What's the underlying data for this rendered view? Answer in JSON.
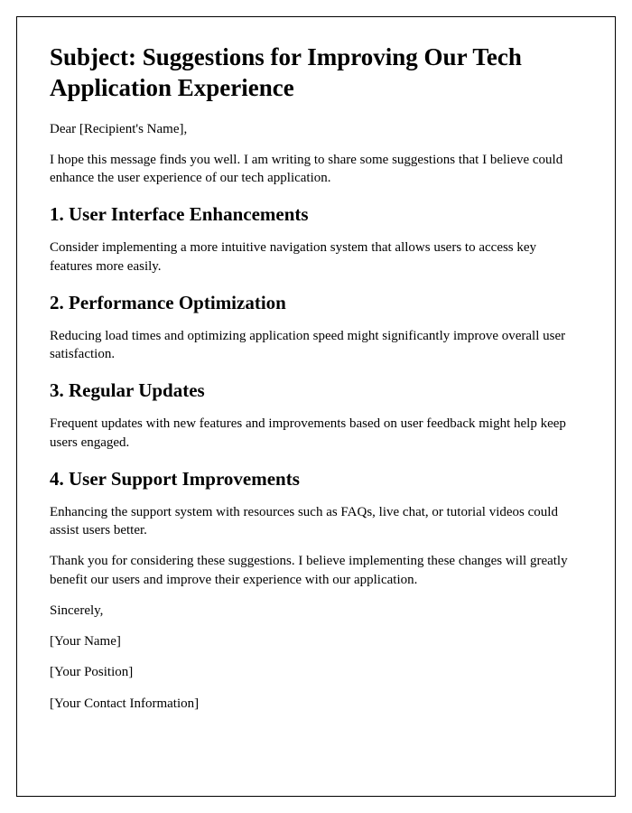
{
  "subject_line": "Subject: Suggestions for Improving Our Tech Application Experience",
  "salutation": "Dear [Recipient's Name],",
  "intro": "I hope this message finds you well. I am writing to share some suggestions that I believe could enhance the user experience of our tech application.",
  "sections": [
    {
      "heading": "1. User Interface Enhancements",
      "body": "Consider implementing a more intuitive navigation system that allows users to access key features more easily."
    },
    {
      "heading": "2. Performance Optimization",
      "body": "Reducing load times and optimizing application speed might significantly improve overall user satisfaction."
    },
    {
      "heading": "3. Regular Updates",
      "body": "Frequent updates with new features and improvements based on user feedback might help keep users engaged."
    },
    {
      "heading": "4. User Support Improvements",
      "body": "Enhancing the support system with resources such as FAQs, live chat, or tutorial videos could assist users better."
    }
  ],
  "closing_paragraph": "Thank you for considering these suggestions. I believe implementing these changes will greatly benefit our users and improve their experience with our application.",
  "signoff": "Sincerely,",
  "signature_name": "[Your Name]",
  "signature_position": "[Your Position]",
  "signature_contact": "[Your Contact Information]"
}
